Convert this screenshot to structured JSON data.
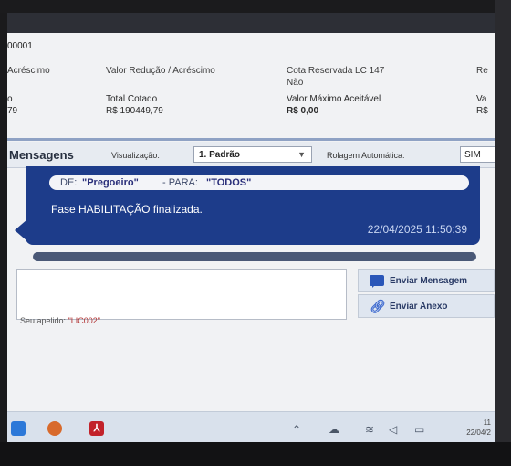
{
  "header": {
    "process_id": "00001",
    "columns": [
      {
        "label": "Acréscimo",
        "value_label": "o",
        "value": "79"
      },
      {
        "label": "Valor Redução / Acréscimo",
        "value_label": "Total Cotado",
        "value": "R$ 190449,79"
      },
      {
        "label": "Cota Reservada LC 147",
        "sub": "Não",
        "value_label": "Valor Máximo Aceitável",
        "value": "R$ 0,00"
      },
      {
        "label": "Re",
        "value_label": "Va",
        "value": "R$"
      }
    ]
  },
  "messages_panel": {
    "title": "Mensagens",
    "view_label": "Visualização:",
    "view_value": "1. Padrão",
    "autoscroll_label": "Rolagem Automática:",
    "autoscroll_value": "SIM"
  },
  "message": {
    "de_label": "DE:",
    "from": "\"Pregoeiro\"",
    "para_label": "- PARA:",
    "to": "\"TODOS\"",
    "text": "Fase HABILITAÇÃO finalizada.",
    "timestamp": "22/04/2025 11:50:39"
  },
  "compose": {
    "send_label": "Enviar Mensagem",
    "attach_label": "Enviar Anexo",
    "nickname_label": "Seu apelido:",
    "nickname_value": "\"LIC002\""
  },
  "taskbar": {
    "clock_time": "11",
    "clock_date": "22/04/2"
  },
  "colors": {
    "bubble": "#1d3c8a",
    "panel": "#e7ebf1",
    "accent": "#2a56b8"
  }
}
